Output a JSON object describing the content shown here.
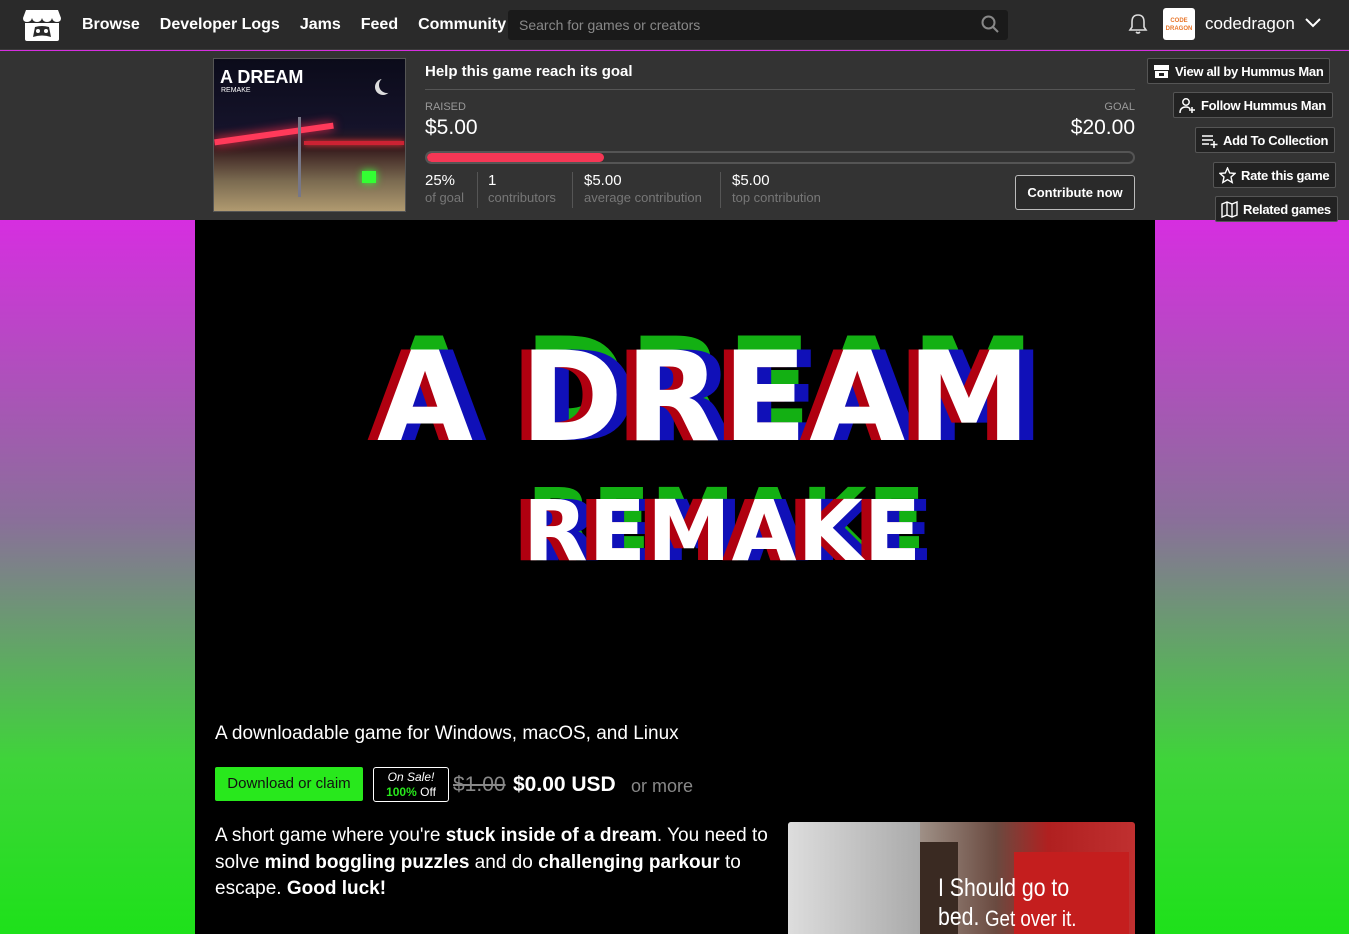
{
  "header": {
    "nav": [
      "Browse",
      "Developer Logs",
      "Jams",
      "Feed",
      "Community"
    ],
    "search_placeholder": "Search for games or creators",
    "username": "codedragon",
    "avatar_text": "CODE DRAGON"
  },
  "fund": {
    "thumb_title": "A DREAM",
    "thumb_sub": "REMAKE",
    "title": "Help this game reach its goal",
    "raised_label": "RAISED",
    "raised": "$5.00",
    "goal_label": "GOAL",
    "goal": "$20.00",
    "progress_fraction": 0.25,
    "stats": [
      {
        "value": "25%",
        "label": "of goal"
      },
      {
        "value": "1",
        "label": "contributors"
      },
      {
        "value": "$5.00",
        "label": "average contribution"
      },
      {
        "value": "$5.00",
        "label": "top contribution"
      }
    ],
    "contribute_label": "Contribute now"
  },
  "side_buttons": {
    "view_all": "View all by Hummus Man",
    "follow": "Follow Hummus Man",
    "collection": "Add To Collection",
    "rate": "Rate this game",
    "related": "Related games"
  },
  "game": {
    "banner_title": "A DREAM",
    "banner_sub": "REMAKE",
    "subtitle": "A downloadable game for Windows, macOS, and Linux",
    "download_label": "Download or claim",
    "sale_on": "On Sale!",
    "sale_pct": "100%",
    "sale_off": "Off",
    "old_price": "$1.00",
    "new_price": "$0.00 USD",
    "or_more": "or more",
    "desc": {
      "p1": "A short game where you're ",
      "b1": "stuck inside of a dream",
      "p2": ". You need to solve ",
      "b2": "mind boggling puzzles",
      "p3": " and do ",
      "b3": "challenging parkour",
      "p4": " to escape. ",
      "b4": "Good luck!"
    },
    "screenshot_line1": "I Should go to bed.",
    "screenshot_line2": "Get over it."
  },
  "colors": {
    "accent_red": "#f53755",
    "download_green": "#28e81c"
  }
}
